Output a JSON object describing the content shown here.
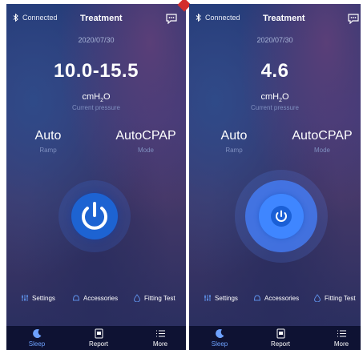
{
  "screens": [
    {
      "status": "Connected",
      "title": "Treatment",
      "date": "2020/07/30",
      "pressure_value": "10.0-15.5",
      "unit_main": "cmH",
      "unit_sub": "2",
      "unit_tail": "O",
      "pressure_caption": "Current pressure",
      "ramp_value": "Auto",
      "ramp_caption": "Ramp",
      "mode_value": "AutoCPAP",
      "mode_caption": "Mode",
      "power_state": "off"
    },
    {
      "status": "Connected",
      "title": "Treatment",
      "date": "2020/07/30",
      "pressure_value": "4.6",
      "unit_main": "cmH",
      "unit_sub": "2",
      "unit_tail": "O",
      "pressure_caption": "Current pressure",
      "ramp_value": "Auto",
      "ramp_caption": "Ramp",
      "mode_value": "AutoCPAP",
      "mode_caption": "Mode",
      "power_state": "running"
    }
  ],
  "quick_links": {
    "settings": "Settings",
    "accessories": "Accessories",
    "fitting_test": "Fitting Test"
  },
  "nav": {
    "sleep": "Sleep",
    "report": "Report",
    "more": "More"
  },
  "colors": {
    "accent": "#1e6ad8",
    "active_nav": "#6ea2ff",
    "bottom_bar": "#0e1233"
  },
  "icons": [
    "bluetooth-icon",
    "chat-icon",
    "power-icon",
    "settings-sliders-icon",
    "accessories-mask-icon",
    "fitting-drop-icon",
    "moon-icon",
    "report-icon",
    "more-list-icon"
  ]
}
